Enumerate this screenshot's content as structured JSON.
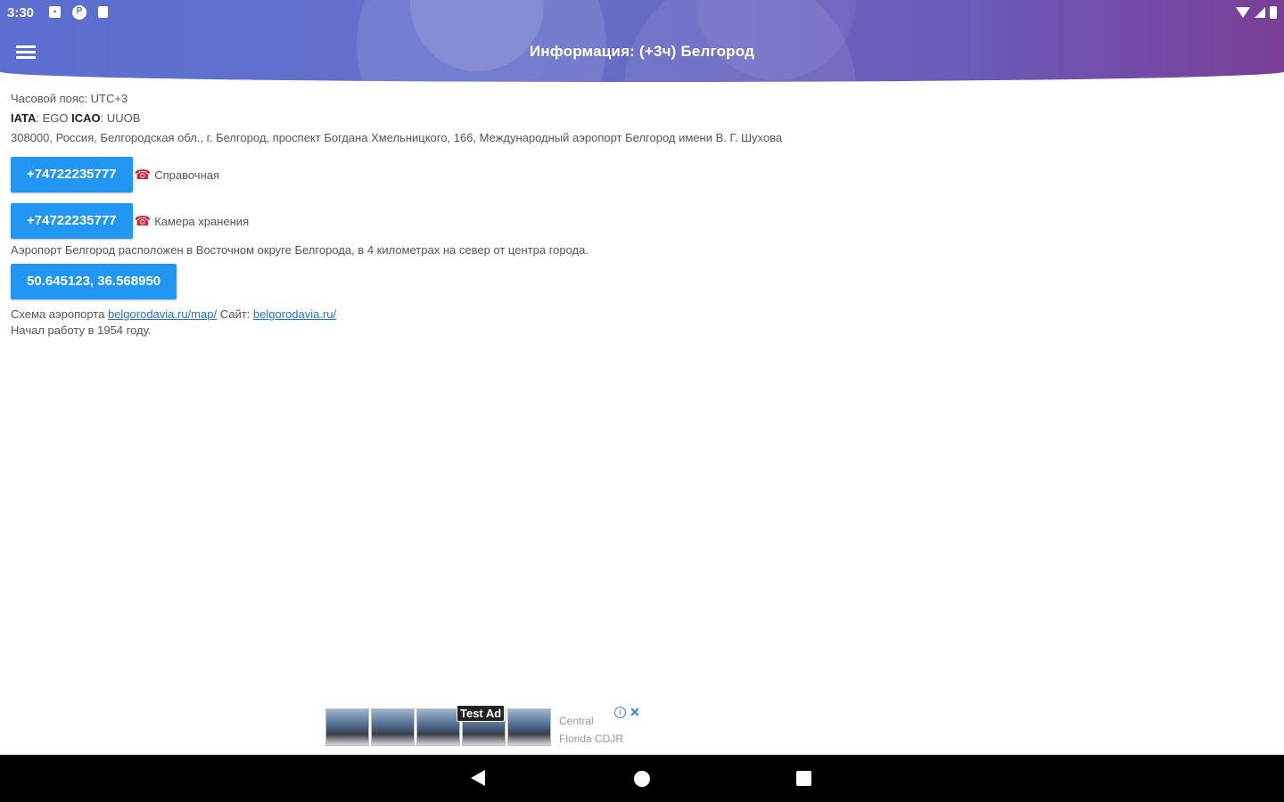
{
  "status_bar": {
    "time": "3:30",
    "left_icons": [
      "notification-icon",
      "p-icon",
      "sd-card-icon"
    ],
    "right_icons": [
      "wifi-icon",
      "signal-icon",
      "battery-icon"
    ]
  },
  "toolbar": {
    "menu_icon": "hamburger-menu-icon",
    "title": "Информация: (+3ч) Белгород"
  },
  "info": {
    "timezone": "Часовой пояс: UTC+3",
    "iata_label": "IATA",
    "iata_value": ": EGO",
    "icao_label": "ICAO",
    "icao_value": ": UUOB",
    "address": "308000, Россия, Белгородская обл., г. Белгород, проспект Богдана Хмельницкого, 166, Международный аэропорт Белгород имени В. Г. Шухова"
  },
  "phones": [
    {
      "number": "+74722235777",
      "icon": "☎",
      "label": "Справочная"
    },
    {
      "number": "+74722235777",
      "icon": "☎",
      "label": "Камера хранения"
    }
  ],
  "description": "Аэропорт Белгород расположен в Восточном округе Белгорода, в 4 километрах на север от центра города.",
  "coordinates": "50.645123, 36.568950",
  "scheme": {
    "label": "Схема аэропорта ",
    "link": "belgorodavia.ru/map/",
    "site_label": " Сайт: ",
    "site_link": "belgorodavia.ru/"
  },
  "founded": "Начал работу в 1954 году.",
  "ad": {
    "badge": "Test Ad",
    "advertiser_line1": "Central",
    "advertiser_line2": "Florida CDJR",
    "info_icon": "i",
    "close_icon": "✕"
  },
  "nav": {
    "back": "back-icon",
    "home": "home-icon",
    "recents": "recents-icon"
  }
}
